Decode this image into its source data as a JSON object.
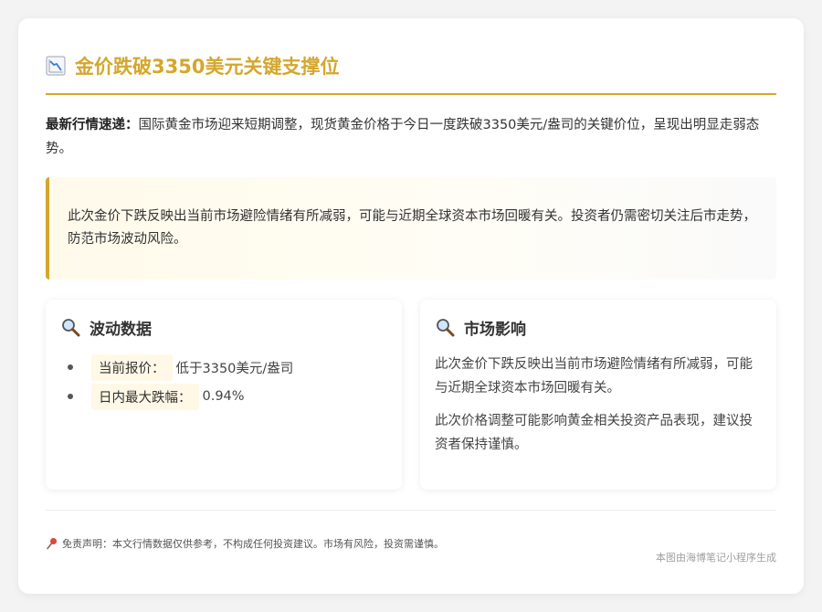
{
  "header": {
    "title": "金价跌破3350美元关键支撑位",
    "icon": "chart-decreasing-icon"
  },
  "intro": {
    "label": "最新行情速递：",
    "text": "国际黄金市场迎来短期调整，现货黄金价格于今日一度跌破3350美元/盎司的关键价位，呈现出明显走弱态势。"
  },
  "callout": {
    "text": "此次金价下跌反映出当前市场避险情绪有所减弱，可能与近期全球资本市场回暖有关。投资者仍需密切关注后市走势，防范市场波动风险。"
  },
  "panels": {
    "volatility": {
      "title": "波动数据",
      "icon": "magnifier-icon",
      "items": [
        {
          "label": "当前报价：",
          "value": "低于3350美元/盎司"
        },
        {
          "label": "日内最大跌幅：",
          "value": "0.94%"
        }
      ]
    },
    "impact": {
      "title": "市场影响",
      "icon": "magnifier-icon",
      "paragraphs": [
        "此次金价下跌反映出当前市场避险情绪有所减弱，可能与近期全球资本市场回暖有关。",
        "此次价格调整可能影响黄金相关投资产品表现，建议投资者保持谨慎。"
      ]
    }
  },
  "disclaimer": {
    "icon": "pushpin-icon",
    "text": "免责声明：本文行情数据仅供参考，不构成任何投资建议。市场有风险，投资需谨慎。"
  },
  "footer": {
    "note": "本图由海博笔记小程序生成"
  },
  "colors": {
    "accent": "#d4a72c",
    "callout_bg": "#fffaea",
    "badge_bg": "#fff8e6"
  }
}
